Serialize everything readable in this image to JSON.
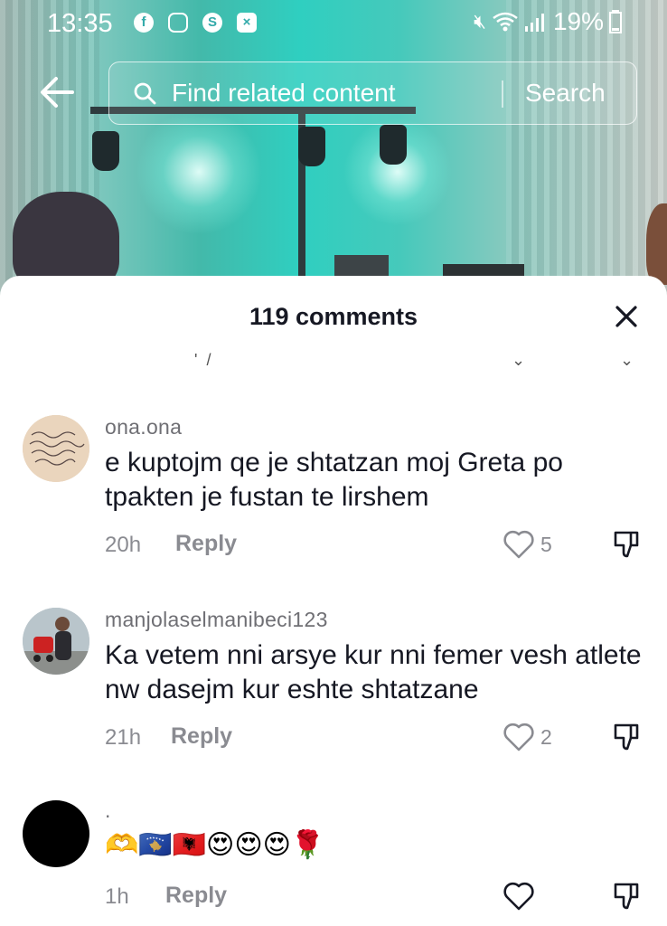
{
  "status_bar": {
    "time": "13:35",
    "battery": "19%",
    "apps": [
      "facebook-icon",
      "instagram-icon",
      "app-s-icon",
      "app-x-icon"
    ],
    "icons": [
      "mute-icon",
      "wifi-icon",
      "signal-icon",
      "battery-icon"
    ]
  },
  "search": {
    "placeholder": "Find related content",
    "button_label": "Search"
  },
  "sheet": {
    "title": "119 comments"
  },
  "comments": [
    {
      "username": "ona.ona",
      "text": "e kuptojm qe je shtatzan moj Greta po tpakten je fustan te lirshem",
      "time": "20h",
      "reply_label": "Reply",
      "likes": "5"
    },
    {
      "username": "manjolaselmanibeci123",
      "text": "Ka vetem nni arsye kur nni femer vesh atlete nw dasejm kur eshte shtatzane",
      "time": "21h",
      "reply_label": "Reply",
      "likes": "2"
    },
    {
      "username": ".",
      "text": "🫶🇽🇰🇦🇱😍😍😍🌹",
      "time": "1h",
      "reply_label": "Reply",
      "likes": ""
    }
  ],
  "colors": {
    "text_primary": "#161823",
    "text_secondary": "#8a8b91",
    "video_accent": "#2fcfc0"
  }
}
